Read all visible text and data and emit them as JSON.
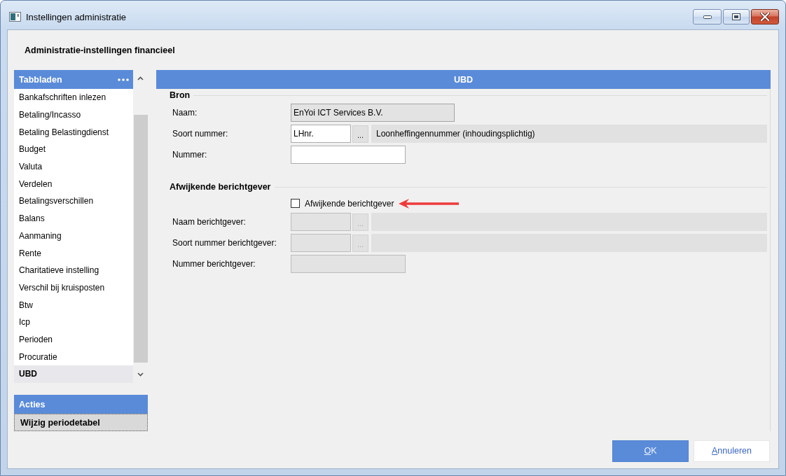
{
  "window": {
    "title": "Instellingen administratie"
  },
  "heading": "Administratie-instellingen financieel",
  "sidebar": {
    "title": "Tabbladen",
    "items": [
      {
        "label": "Bankafschriften inlezen",
        "selected": false
      },
      {
        "label": "Betaling/Incasso",
        "selected": false
      },
      {
        "label": "Betaling Belastingdienst",
        "selected": false
      },
      {
        "label": "Budget",
        "selected": false
      },
      {
        "label": "Valuta",
        "selected": false
      },
      {
        "label": "Verdelen",
        "selected": false
      },
      {
        "label": "Betalingsverschillen",
        "selected": false
      },
      {
        "label": "Balans",
        "selected": false
      },
      {
        "label": "Aanmaning",
        "selected": false
      },
      {
        "label": "Rente",
        "selected": false
      },
      {
        "label": "Charitatieve instelling",
        "selected": false
      },
      {
        "label": "Verschil bij kruisposten",
        "selected": false
      },
      {
        "label": "Btw",
        "selected": false
      },
      {
        "label": "Icp",
        "selected": false
      },
      {
        "label": "Perioden",
        "selected": false
      },
      {
        "label": "Procuratie",
        "selected": false
      },
      {
        "label": "UBD",
        "selected": true
      }
    ]
  },
  "actions": {
    "title": "Acties",
    "items": [
      {
        "label": "Wijzig periodetabel",
        "focused": true
      }
    ]
  },
  "panel": {
    "title": "UBD",
    "groups": [
      {
        "title": "Bron",
        "rows": [
          {
            "kind": "readonly",
            "label": "Naam:",
            "value": "EnYoi ICT Services B.V."
          },
          {
            "kind": "lookup",
            "label": "Soort nummer:",
            "value": "LHnr.",
            "button": "...",
            "description": "Loonheffingennummer (inhoudingsplichtig)",
            "disabled": false
          },
          {
            "kind": "text",
            "label": "Nummer:",
            "disabled": false
          }
        ]
      },
      {
        "title": "Afwijkende berichtgever",
        "rows": [
          {
            "kind": "checkbox",
            "label": "Afwijkende berichtgever",
            "checked": false,
            "highlighted": true
          },
          {
            "kind": "lookup",
            "label": "Naam berichtgever:",
            "button": "...",
            "disabled": true
          },
          {
            "kind": "lookup",
            "label": "Soort nummer berichtgever:",
            "button": "...",
            "disabled": true
          },
          {
            "kind": "text",
            "label": "Nummer berichtgever:",
            "disabled": true
          }
        ]
      }
    ]
  },
  "buttons": [
    {
      "label": "OK",
      "kind": "confirm"
    },
    {
      "label": "Annuleren",
      "kind": "cancel"
    }
  ]
}
